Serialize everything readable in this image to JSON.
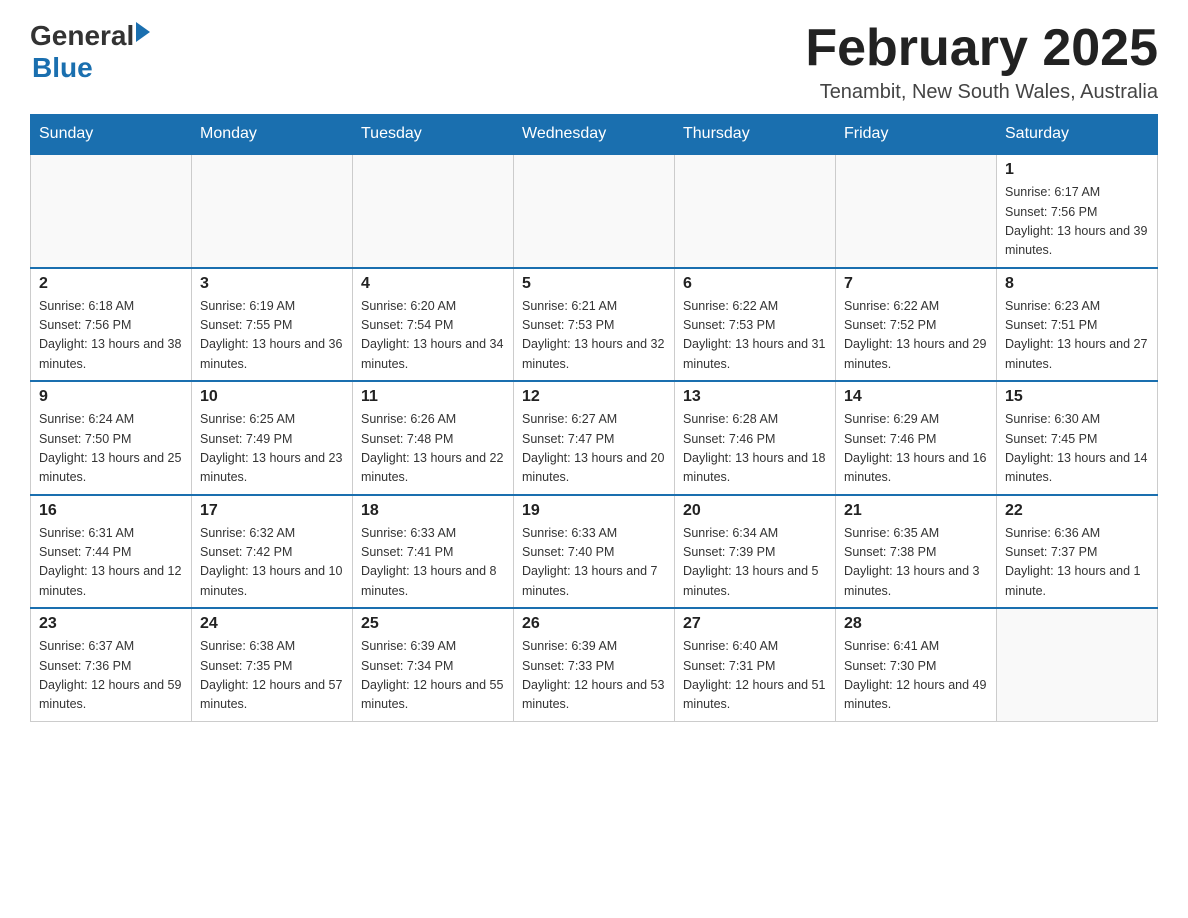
{
  "header": {
    "title": "February 2025",
    "location": "Tenambit, New South Wales, Australia",
    "logo_general": "General",
    "logo_blue": "Blue"
  },
  "days_of_week": [
    "Sunday",
    "Monday",
    "Tuesday",
    "Wednesday",
    "Thursday",
    "Friday",
    "Saturday"
  ],
  "weeks": [
    [
      {
        "day": "",
        "info": ""
      },
      {
        "day": "",
        "info": ""
      },
      {
        "day": "",
        "info": ""
      },
      {
        "day": "",
        "info": ""
      },
      {
        "day": "",
        "info": ""
      },
      {
        "day": "",
        "info": ""
      },
      {
        "day": "1",
        "info": "Sunrise: 6:17 AM\nSunset: 7:56 PM\nDaylight: 13 hours and 39 minutes."
      }
    ],
    [
      {
        "day": "2",
        "info": "Sunrise: 6:18 AM\nSunset: 7:56 PM\nDaylight: 13 hours and 38 minutes."
      },
      {
        "day": "3",
        "info": "Sunrise: 6:19 AM\nSunset: 7:55 PM\nDaylight: 13 hours and 36 minutes."
      },
      {
        "day": "4",
        "info": "Sunrise: 6:20 AM\nSunset: 7:54 PM\nDaylight: 13 hours and 34 minutes."
      },
      {
        "day": "5",
        "info": "Sunrise: 6:21 AM\nSunset: 7:53 PM\nDaylight: 13 hours and 32 minutes."
      },
      {
        "day": "6",
        "info": "Sunrise: 6:22 AM\nSunset: 7:53 PM\nDaylight: 13 hours and 31 minutes."
      },
      {
        "day": "7",
        "info": "Sunrise: 6:22 AM\nSunset: 7:52 PM\nDaylight: 13 hours and 29 minutes."
      },
      {
        "day": "8",
        "info": "Sunrise: 6:23 AM\nSunset: 7:51 PM\nDaylight: 13 hours and 27 minutes."
      }
    ],
    [
      {
        "day": "9",
        "info": "Sunrise: 6:24 AM\nSunset: 7:50 PM\nDaylight: 13 hours and 25 minutes."
      },
      {
        "day": "10",
        "info": "Sunrise: 6:25 AM\nSunset: 7:49 PM\nDaylight: 13 hours and 23 minutes."
      },
      {
        "day": "11",
        "info": "Sunrise: 6:26 AM\nSunset: 7:48 PM\nDaylight: 13 hours and 22 minutes."
      },
      {
        "day": "12",
        "info": "Sunrise: 6:27 AM\nSunset: 7:47 PM\nDaylight: 13 hours and 20 minutes."
      },
      {
        "day": "13",
        "info": "Sunrise: 6:28 AM\nSunset: 7:46 PM\nDaylight: 13 hours and 18 minutes."
      },
      {
        "day": "14",
        "info": "Sunrise: 6:29 AM\nSunset: 7:46 PM\nDaylight: 13 hours and 16 minutes."
      },
      {
        "day": "15",
        "info": "Sunrise: 6:30 AM\nSunset: 7:45 PM\nDaylight: 13 hours and 14 minutes."
      }
    ],
    [
      {
        "day": "16",
        "info": "Sunrise: 6:31 AM\nSunset: 7:44 PM\nDaylight: 13 hours and 12 minutes."
      },
      {
        "day": "17",
        "info": "Sunrise: 6:32 AM\nSunset: 7:42 PM\nDaylight: 13 hours and 10 minutes."
      },
      {
        "day": "18",
        "info": "Sunrise: 6:33 AM\nSunset: 7:41 PM\nDaylight: 13 hours and 8 minutes."
      },
      {
        "day": "19",
        "info": "Sunrise: 6:33 AM\nSunset: 7:40 PM\nDaylight: 13 hours and 7 minutes."
      },
      {
        "day": "20",
        "info": "Sunrise: 6:34 AM\nSunset: 7:39 PM\nDaylight: 13 hours and 5 minutes."
      },
      {
        "day": "21",
        "info": "Sunrise: 6:35 AM\nSunset: 7:38 PM\nDaylight: 13 hours and 3 minutes."
      },
      {
        "day": "22",
        "info": "Sunrise: 6:36 AM\nSunset: 7:37 PM\nDaylight: 13 hours and 1 minute."
      }
    ],
    [
      {
        "day": "23",
        "info": "Sunrise: 6:37 AM\nSunset: 7:36 PM\nDaylight: 12 hours and 59 minutes."
      },
      {
        "day": "24",
        "info": "Sunrise: 6:38 AM\nSunset: 7:35 PM\nDaylight: 12 hours and 57 minutes."
      },
      {
        "day": "25",
        "info": "Sunrise: 6:39 AM\nSunset: 7:34 PM\nDaylight: 12 hours and 55 minutes."
      },
      {
        "day": "26",
        "info": "Sunrise: 6:39 AM\nSunset: 7:33 PM\nDaylight: 12 hours and 53 minutes."
      },
      {
        "day": "27",
        "info": "Sunrise: 6:40 AM\nSunset: 7:31 PM\nDaylight: 12 hours and 51 minutes."
      },
      {
        "day": "28",
        "info": "Sunrise: 6:41 AM\nSunset: 7:30 PM\nDaylight: 12 hours and 49 minutes."
      },
      {
        "day": "",
        "info": ""
      }
    ]
  ]
}
